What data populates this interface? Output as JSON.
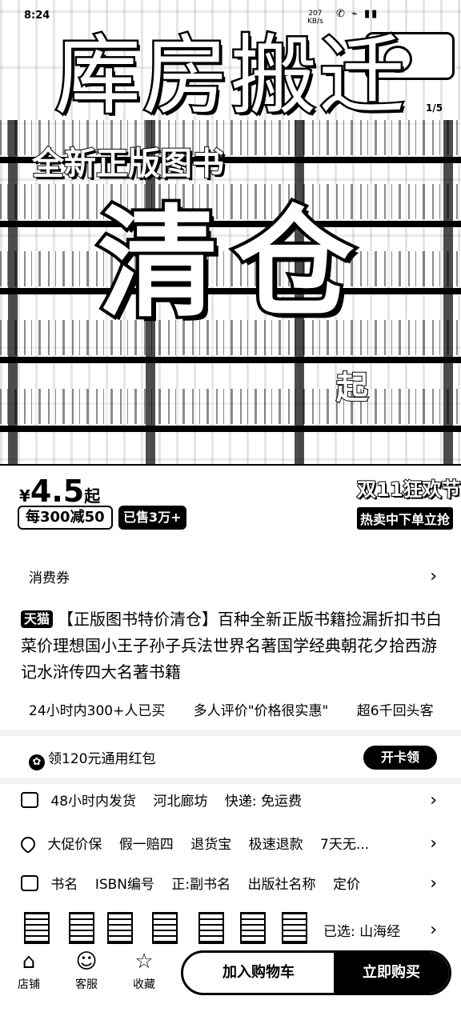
{
  "status_bar": {
    "time": "8:24",
    "speed_top": "207",
    "speed_bottom": "KB/s",
    "icons": "✆ ⌁ ▮▮"
  },
  "hero": {
    "title": "库房搬迁",
    "subtitle": "全新正版图书",
    "headline": "清仓",
    "side_mark": "1/5",
    "corner_mark": "起"
  },
  "price_strip": {
    "currency": "¥",
    "price": "4.5",
    "price_suffix": "起",
    "promo": "每300减50",
    "sold": "已售3万+",
    "festival": "双11狂欢节",
    "festival_sub": "热卖中下单立抢"
  },
  "coupon": {
    "label": "消费券"
  },
  "product": {
    "badge": "天猫",
    "title": "【正版图书特价清仓】百种全新正版书籍捡漏折扣书白菜价理想国小王子孙子兵法世界名著国学经典朝花夕拾西游记水浒传四大名著书籍"
  },
  "highlights": [
    "24小时内300+人已买",
    "多人评价\"价格很实惠\"",
    "超6千回头客"
  ],
  "redpacket": {
    "icon": "✿",
    "label": "领120元通用红包",
    "button": "开卡领"
  },
  "shipping": {
    "items": [
      "48小时内发货",
      "河北廊坊",
      "快递: 免运费"
    ]
  },
  "guarantee": {
    "items": [
      "大促价保",
      "假一赔四",
      "退货宝",
      "极速退款",
      "7天无..."
    ]
  },
  "params": {
    "items": [
      "书名",
      "ISBN编号",
      "正:副书名",
      "出版社名称",
      "定价"
    ]
  },
  "variants": {
    "selected": "已选: 山海经"
  },
  "bottom_nav": {
    "store": {
      "icon": "⌂",
      "label": "店铺"
    },
    "service": {
      "icon": "☺",
      "label": "客服"
    },
    "favorite": {
      "icon": "☆",
      "label": "收藏"
    },
    "cart_label": "加入购物车",
    "buy_label": "立即购买"
  }
}
